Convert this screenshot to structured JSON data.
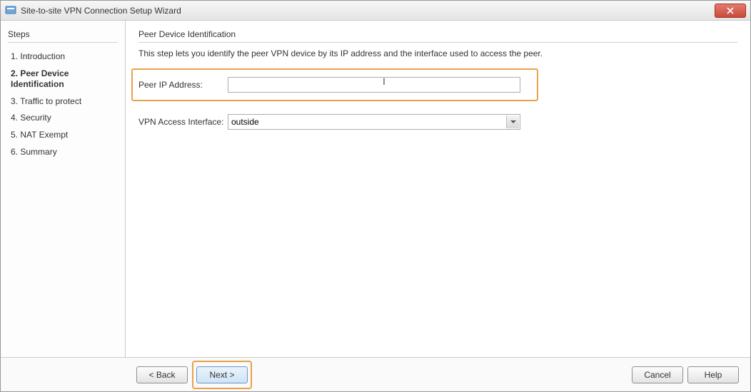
{
  "window": {
    "title": "Site-to-site VPN Connection Setup Wizard"
  },
  "sidebar": {
    "title": "Steps",
    "steps": [
      {
        "num": "1.",
        "label": "Introduction"
      },
      {
        "num": "2.",
        "label": "Peer Device Identification"
      },
      {
        "num": "3.",
        "label": "Traffic to protect"
      },
      {
        "num": "4.",
        "label": "Security"
      },
      {
        "num": "5.",
        "label": "NAT Exempt"
      },
      {
        "num": "6.",
        "label": "Summary"
      }
    ],
    "active_index": 1
  },
  "panel": {
    "title": "Peer Device Identification",
    "description": "This step lets you identify the peer VPN device by its IP address and the interface used to access the peer.",
    "fields": {
      "peer_ip": {
        "label": "Peer IP Address:",
        "value": ""
      },
      "access_if": {
        "label": "VPN Access Interface:",
        "value": "outside"
      }
    }
  },
  "buttons": {
    "back": "< Back",
    "next": "Next >",
    "cancel": "Cancel",
    "help": "Help"
  }
}
